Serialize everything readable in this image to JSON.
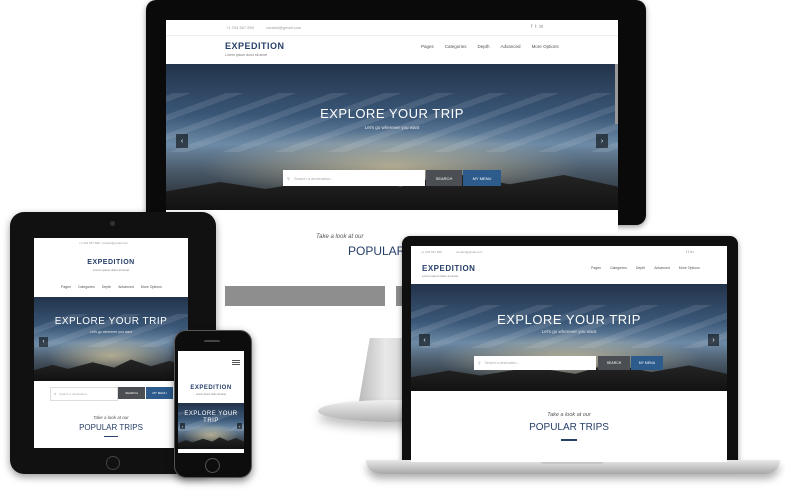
{
  "site": {
    "brand": "EXPEDITION",
    "tagline": "Lorem ipsum dolor sit amet",
    "topbar_phone": "+1 234 567 890",
    "topbar_email": "contact@gmail.com",
    "social_icons": [
      "facebook-icon",
      "twitter-icon",
      "linkedin-icon"
    ],
    "nav": [
      "Pages",
      "Categories",
      "Depth",
      "Advanced",
      "More Options"
    ]
  },
  "hero": {
    "title": "EXPLORE YOUR TRIP",
    "subtitle": "Let's go wherever you want",
    "search_placeholder": "Search a destination...",
    "search_button": "SEARCH",
    "my_menu_button": "MY MENU"
  },
  "section": {
    "kicker": "Take a look at our",
    "title": "POPULAR TRIPS",
    "title_partial": "POPULAR"
  },
  "colors": {
    "brand": "#27406a",
    "button_blue": "#2c5b8c",
    "button_gray": "#4b4e52"
  }
}
